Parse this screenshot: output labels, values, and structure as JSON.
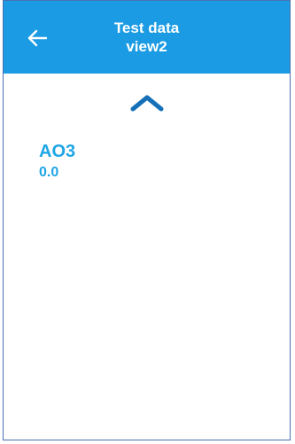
{
  "header": {
    "title_line1": "Test data",
    "title_line2": "view2",
    "back_icon": "arrow-left-icon"
  },
  "navigation": {
    "scroll_up_icon": "chevron-up-icon"
  },
  "items": [
    {
      "label": "AO3",
      "value": "0.0"
    }
  ],
  "colors": {
    "header_bg": "#1a9be3",
    "accent": "#1ea5e6",
    "border": "#4a6fb0"
  }
}
